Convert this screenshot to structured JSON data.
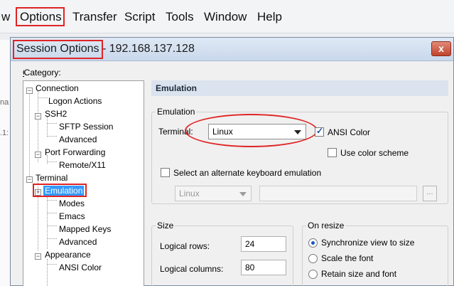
{
  "app": {
    "menu_fragment": "w",
    "menu": [
      "Options",
      "Transfer",
      "Script",
      "Tools",
      "Window",
      "Help"
    ],
    "bg_fragments": [
      "na",
      ".1:"
    ]
  },
  "dialog": {
    "title_main": "Session Options",
    "title_ip": " - 192.168.137.128",
    "close_label": "x",
    "category_label": "Category:",
    "tree": [
      {
        "label": "Connection",
        "level": 0,
        "expander": "minus"
      },
      {
        "label": "Logon Actions",
        "level": 1
      },
      {
        "label": "SSH2",
        "level": 1,
        "expander": "minus"
      },
      {
        "label": "SFTP Session",
        "level": 2
      },
      {
        "label": "Advanced",
        "level": 2
      },
      {
        "label": "Port Forwarding",
        "level": 1,
        "expander": "minus"
      },
      {
        "label": "Remote/X11",
        "level": 2
      },
      {
        "label": "Terminal",
        "level": 0,
        "expander": "minus"
      },
      {
        "label": "Emulation",
        "level": 1,
        "expander": "plus",
        "selected": true
      },
      {
        "label": "Modes",
        "level": 2
      },
      {
        "label": "Emacs",
        "level": 2
      },
      {
        "label": "Mapped Keys",
        "level": 2
      },
      {
        "label": "Advanced",
        "level": 2
      },
      {
        "label": "Appearance",
        "level": 1,
        "expander": "minus"
      },
      {
        "label": "ANSI Color",
        "level": 2
      }
    ],
    "section_header": "Emulation",
    "emulation_group": "Emulation",
    "terminal_label": "Terminal:",
    "terminal_value": "Linux",
    "ansi_color_label": "ANSI Color",
    "ansi_color_checked": true,
    "use_scheme_label": "Use color scheme",
    "use_scheme_checked": false,
    "alt_keyboard_label": "Select an alternate keyboard emulation",
    "alt_keyboard_checked": false,
    "alt_keyboard_value": "Linux",
    "alt_keyboard_path": "",
    "browse_label": "...",
    "size_group": "Size",
    "logical_rows_label": "Logical rows:",
    "logical_rows_value": "24",
    "logical_columns_label": "Logical columns:",
    "logical_columns_value": "80",
    "on_resize_group": "On resize",
    "resize_options": [
      {
        "label": "Synchronize view to size",
        "selected": true
      },
      {
        "label": "Scale the font",
        "selected": false
      },
      {
        "label": "Retain size and font",
        "selected": false
      }
    ]
  },
  "colors": {
    "annotation": "#e02424",
    "selection": "#3399ff",
    "header_bg": "#dbe3ee"
  }
}
